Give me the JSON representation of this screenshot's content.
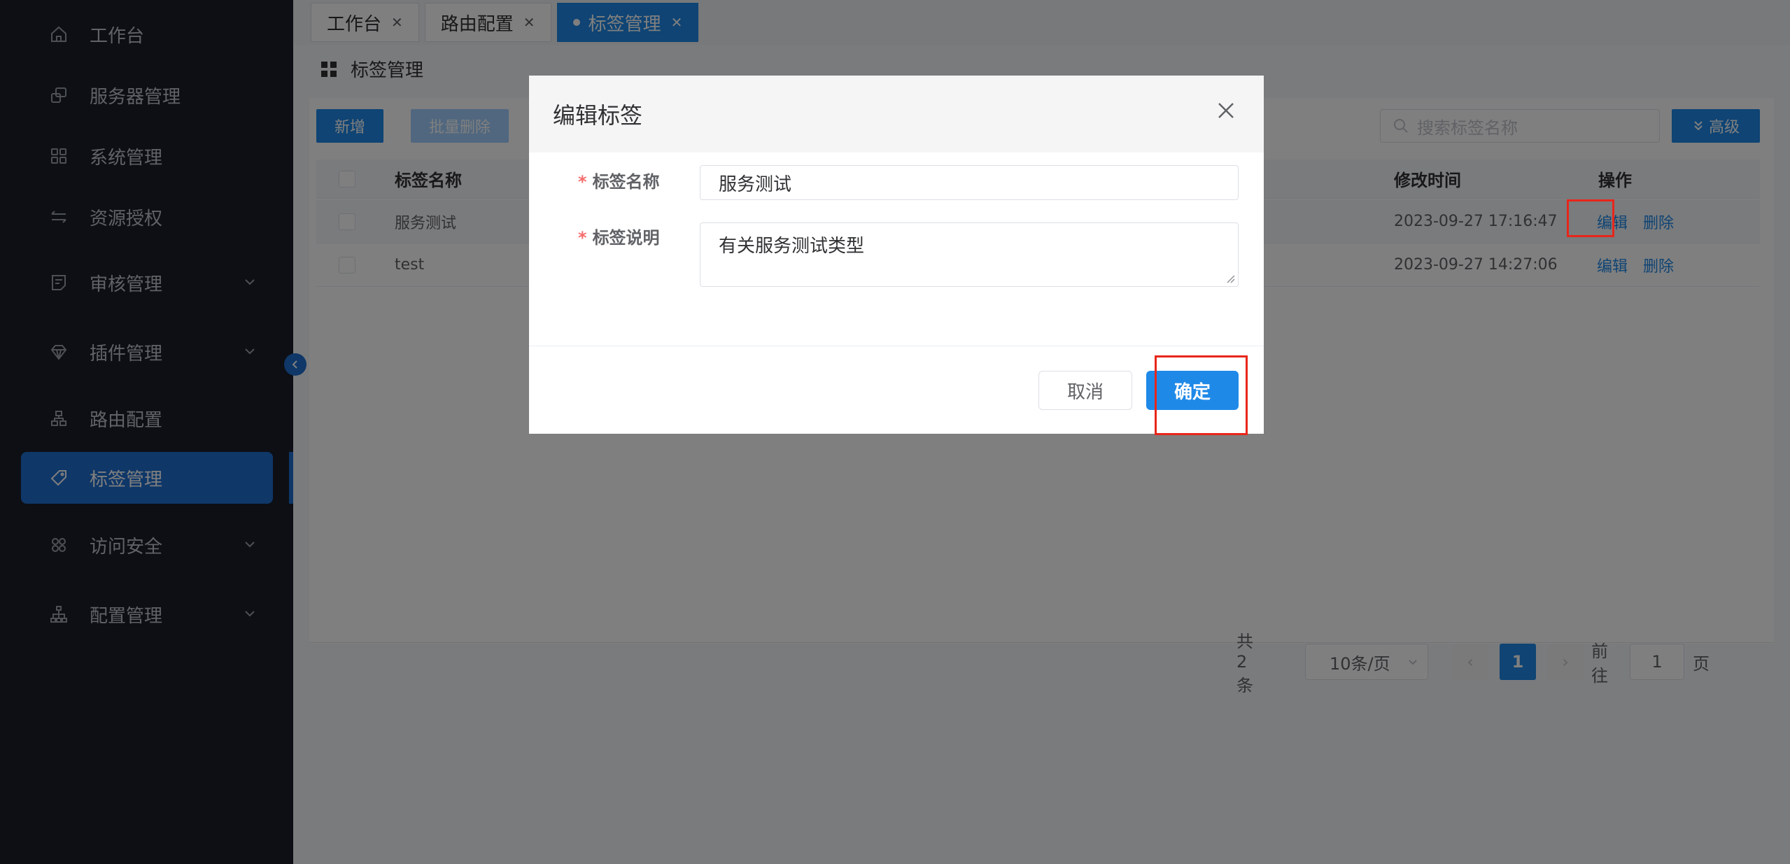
{
  "sidebar": {
    "items": [
      {
        "label": "工作台",
        "icon": "home-icon",
        "expandable": false
      },
      {
        "label": "服务器管理",
        "icon": "server-icon",
        "expandable": false
      },
      {
        "label": "系统管理",
        "icon": "grid-icon",
        "expandable": false
      },
      {
        "label": "资源授权",
        "icon": "swap-icon",
        "expandable": false
      },
      {
        "label": "审核管理",
        "icon": "audit-icon",
        "expandable": true
      },
      {
        "label": "插件管理",
        "icon": "diamond-icon",
        "expandable": true
      },
      {
        "label": "路由配置",
        "icon": "route-icon",
        "expandable": false
      },
      {
        "label": "标签管理",
        "icon": "tag-icon",
        "expandable": false,
        "active": true
      },
      {
        "label": "访问安全",
        "icon": "apps-icon",
        "expandable": true
      },
      {
        "label": "配置管理",
        "icon": "tree-icon",
        "expandable": true
      }
    ]
  },
  "tabs": [
    {
      "label": "工作台",
      "active": false
    },
    {
      "label": "路由配置",
      "active": false
    },
    {
      "label": "标签管理",
      "active": true
    }
  ],
  "page": {
    "title": "标签管理"
  },
  "toolbar": {
    "add_label": "新增",
    "batch_delete_label": "批量删除",
    "search_placeholder": "搜索标签名称",
    "advanced_label": "高级"
  },
  "table": {
    "headers": {
      "name": "标签名称",
      "modified": "修改时间",
      "actions": "操作"
    },
    "rows": [
      {
        "name": "服务测试",
        "modified": "2023-09-27 17:16:47",
        "edit": "编辑",
        "delete": "删除"
      },
      {
        "name": "test",
        "modified": "2023-09-27 14:27:06",
        "edit": "编辑",
        "delete": "删除"
      }
    ]
  },
  "pagination": {
    "total": "共 2 条",
    "page_size": "10条/页",
    "current_page": "1",
    "goto_prefix": "前往",
    "goto_value": "1",
    "goto_suffix": "页"
  },
  "dialog": {
    "title": "编辑标签",
    "name_label": "标签名称",
    "name_value": "服务测试",
    "desc_label": "标签说明",
    "desc_value": "有关服务测试类型",
    "required_mark": "*",
    "cancel_label": "取消",
    "confirm_label": "确定"
  },
  "colors": {
    "primary": "#1f89e8",
    "sidebar_bg": "#1b1f2a",
    "sidebar_active": "#1f6fd1",
    "highlight": "#e8261b",
    "required": "#f56c6c"
  }
}
